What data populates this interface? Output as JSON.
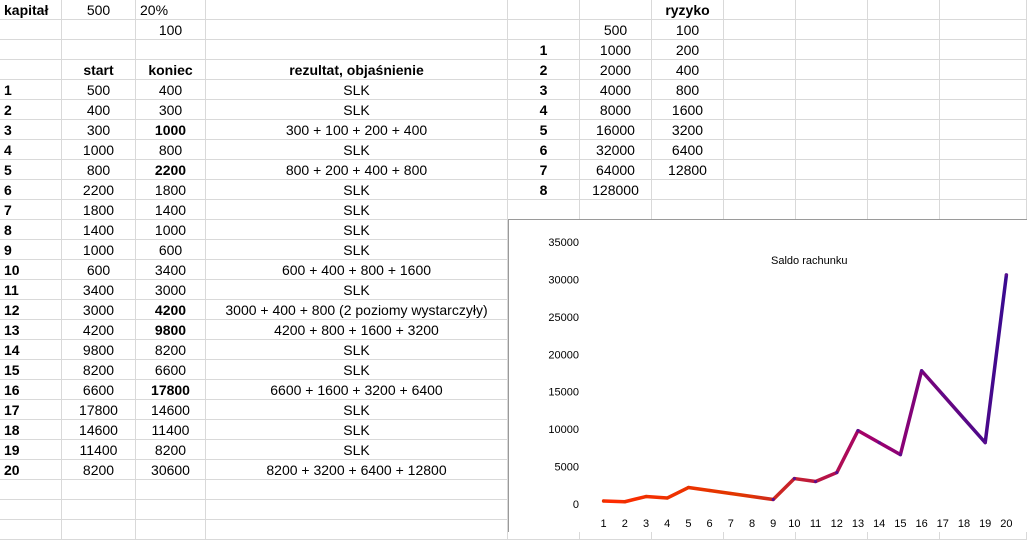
{
  "header": {
    "kapital_label": "kapitał",
    "kapital_value": "500",
    "percent": "20%",
    "stake": "100",
    "ryzyko_label": "ryzyko"
  },
  "table": {
    "columns": [
      "start",
      "koniec",
      "rezultat, objaśnienie"
    ],
    "rows": [
      {
        "n": "1",
        "start": "500",
        "koniec": "400",
        "koniec_bold": false,
        "rezultat": "SLK"
      },
      {
        "n": "2",
        "start": "400",
        "koniec": "300",
        "koniec_bold": false,
        "rezultat": "SLK"
      },
      {
        "n": "3",
        "start": "300",
        "koniec": "1000",
        "koniec_bold": true,
        "rezultat": "300 + 100 + 200 + 400"
      },
      {
        "n": "4",
        "start": "1000",
        "koniec": "800",
        "koniec_bold": false,
        "rezultat": "SLK"
      },
      {
        "n": "5",
        "start": "800",
        "koniec": "2200",
        "koniec_bold": true,
        "rezultat": "800 + 200 + 400 + 800"
      },
      {
        "n": "6",
        "start": "2200",
        "koniec": "1800",
        "koniec_bold": false,
        "rezultat": "SLK"
      },
      {
        "n": "7",
        "start": "1800",
        "koniec": "1400",
        "koniec_bold": false,
        "rezultat": "SLK"
      },
      {
        "n": "8",
        "start": "1400",
        "koniec": "1000",
        "koniec_bold": false,
        "rezultat": "SLK"
      },
      {
        "n": "9",
        "start": "1000",
        "koniec": "600",
        "koniec_bold": false,
        "rezultat": "SLK"
      },
      {
        "n": "10",
        "start": "600",
        "koniec": "3400",
        "koniec_bold": false,
        "rezultat": "600 + 400 + 800 + 1600"
      },
      {
        "n": "11",
        "start": "3400",
        "koniec": "3000",
        "koniec_bold": false,
        "rezultat": "SLK"
      },
      {
        "n": "12",
        "start": "3000",
        "koniec": "4200",
        "koniec_bold": true,
        "rezultat": "3000 + 400 + 800 (2 poziomy wystarczyły)"
      },
      {
        "n": "13",
        "start": "4200",
        "koniec": "9800",
        "koniec_bold": true,
        "rezultat": "4200 + 800 + 1600 + 3200"
      },
      {
        "n": "14",
        "start": "9800",
        "koniec": "8200",
        "koniec_bold": false,
        "rezultat": "SLK"
      },
      {
        "n": "15",
        "start": "8200",
        "koniec": "6600",
        "koniec_bold": false,
        "rezultat": "SLK"
      },
      {
        "n": "16",
        "start": "6600",
        "koniec": "17800",
        "koniec_bold": true,
        "rezultat": "6600 + 1600 + 3200 + 6400"
      },
      {
        "n": "17",
        "start": "17800",
        "koniec": "14600",
        "koniec_bold": false,
        "rezultat": "SLK"
      },
      {
        "n": "18",
        "start": "14600",
        "koniec": "11400",
        "koniec_bold": false,
        "rezultat": "SLK"
      },
      {
        "n": "19",
        "start": "11400",
        "koniec": "8200",
        "koniec_bold": false,
        "rezultat": "SLK"
      },
      {
        "n": "20",
        "start": "8200",
        "koniec": "30600",
        "koniec_bold": false,
        "rezultat": "8200 + 3200 + 6400 + 12800"
      }
    ]
  },
  "levels": {
    "header_base": "500",
    "header_risk": "100",
    "rows": [
      {
        "n": "1",
        "amount": "1000",
        "risk": "200"
      },
      {
        "n": "2",
        "amount": "2000",
        "risk": "400"
      },
      {
        "n": "3",
        "amount": "4000",
        "risk": "800"
      },
      {
        "n": "4",
        "amount": "8000",
        "risk": "1600"
      },
      {
        "n": "5",
        "amount": "16000",
        "risk": "3200"
      },
      {
        "n": "6",
        "amount": "32000",
        "risk": "6400"
      },
      {
        "n": "7",
        "amount": "64000",
        "risk": "12800"
      },
      {
        "n": "8",
        "amount": "128000",
        "risk": ""
      }
    ]
  },
  "chart_data": {
    "type": "line",
    "title": "",
    "xlabel": "",
    "ylabel": "",
    "x": [
      1,
      2,
      3,
      4,
      5,
      6,
      7,
      8,
      9,
      10,
      11,
      12,
      13,
      14,
      15,
      16,
      17,
      18,
      19,
      20
    ],
    "series": [
      {
        "name": "Saldo rachunku",
        "values": [
          400,
          300,
          1000,
          800,
          2200,
          1800,
          1400,
          1000,
          600,
          3400,
          3000,
          4200,
          9800,
          8200,
          6600,
          17800,
          14600,
          11400,
          8200,
          30600
        ]
      }
    ],
    "ylim": [
      0,
      35000
    ],
    "yticks": [
      0,
      5000,
      10000,
      15000,
      20000,
      25000,
      30000,
      35000
    ],
    "xticks": [
      "1",
      "2",
      "3",
      "4",
      "5",
      "6",
      "7",
      "8",
      "9",
      "10",
      "11",
      "12",
      "13",
      "14",
      "15",
      "16",
      "17",
      "18",
      "19",
      "20"
    ],
    "grid": false,
    "legend_position": "top-left",
    "gradient_colors": [
      "#ff2a00",
      "#e03800",
      "#a0006e",
      "#3a0a90"
    ]
  }
}
